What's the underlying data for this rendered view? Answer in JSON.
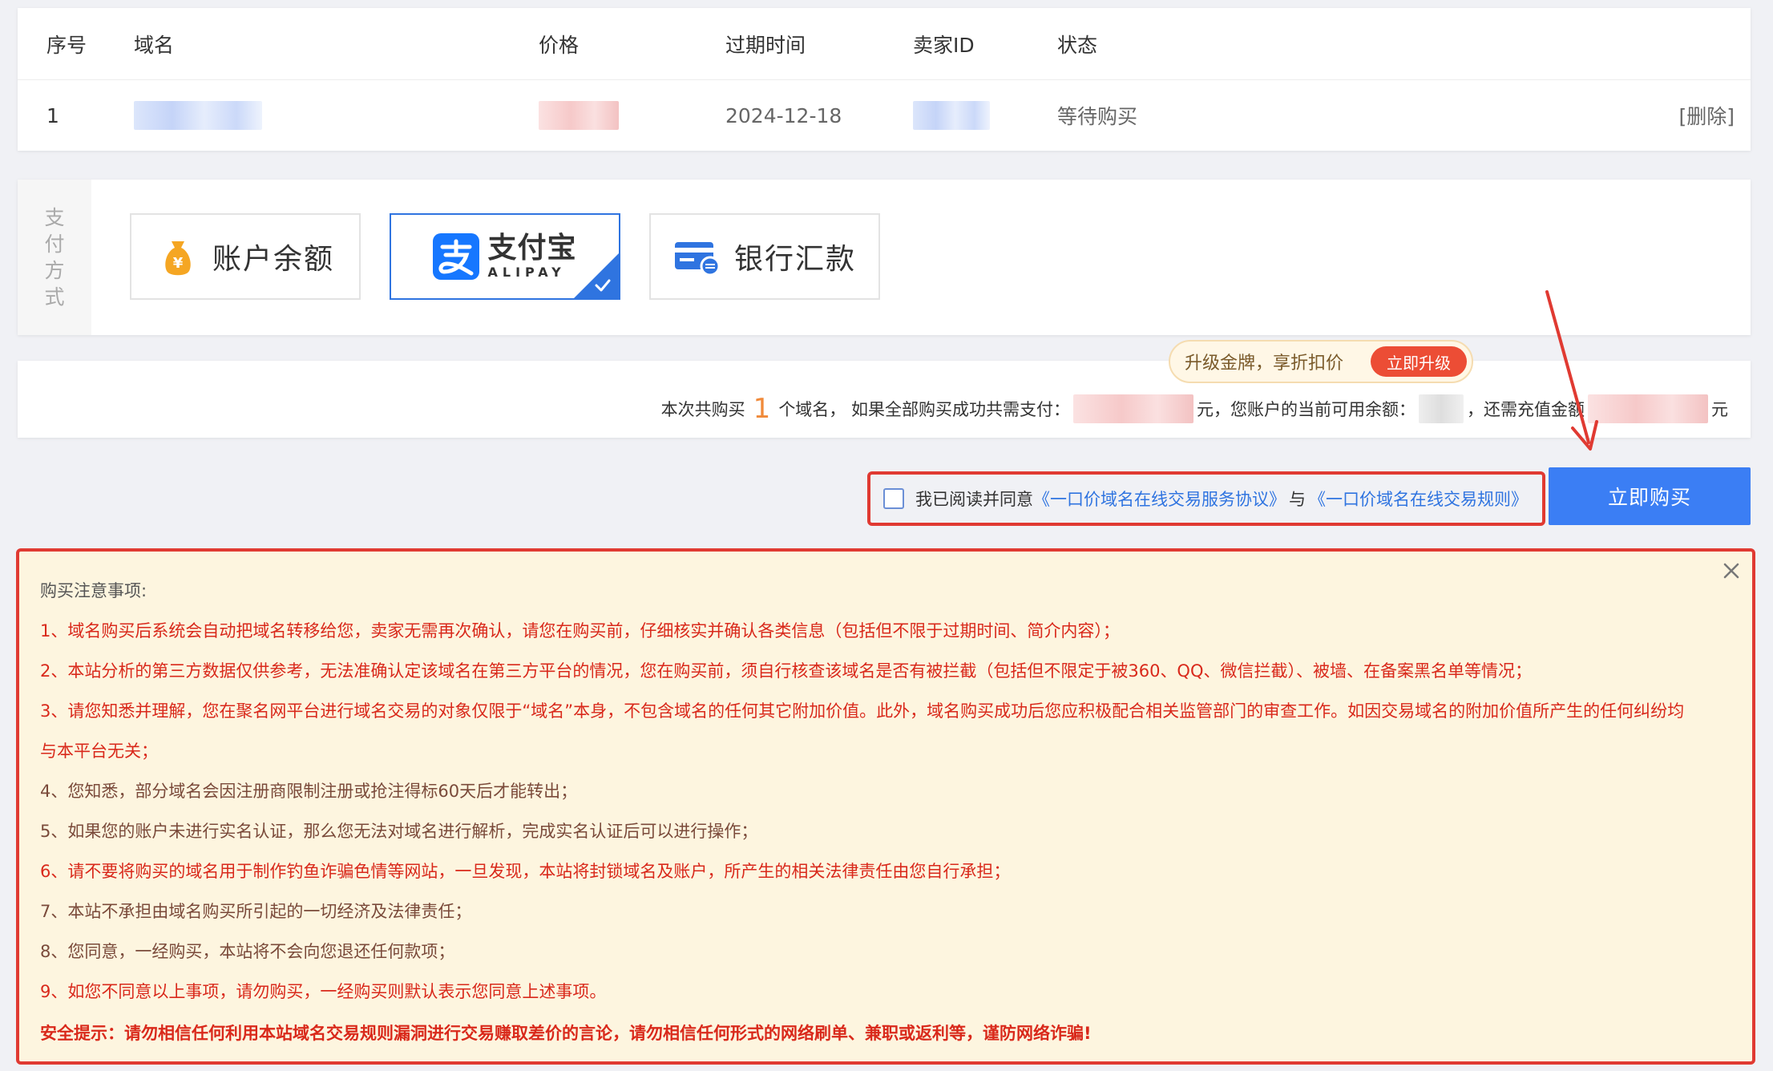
{
  "table": {
    "headers": {
      "index": "序号",
      "domain": "域名",
      "price": "价格",
      "expiry": "过期时间",
      "seller": "卖家ID",
      "status": "状态"
    },
    "rows": [
      {
        "index": "1",
        "expiry": "2024-12-18",
        "status": "等待购买",
        "delete_label": "[删除]"
      }
    ]
  },
  "payment": {
    "label": [
      "支",
      "付",
      "方",
      "式"
    ],
    "options": [
      {
        "label": "账户余额",
        "icon": "money-bag-icon",
        "selected": false
      },
      {
        "label_cn": "支付宝",
        "label_en": "ALIPAY",
        "icon": "alipay-logo-icon",
        "selected": true
      },
      {
        "label": "银行汇款",
        "icon": "bank-card-icon",
        "selected": false
      }
    ]
  },
  "upgrade": {
    "text": "升级金牌，享折扣价",
    "button": "立即升级"
  },
  "summary": {
    "prefix": "本次共购买",
    "count": "1",
    "mid1": "个域名，  如果全部购买成功共需支付：",
    "unit1": "元，",
    "mid2": "您账户的当前可用余额：",
    "mid3": "，还需充值金额",
    "unit2": "元"
  },
  "agree": {
    "text": "我已阅读并同意",
    "link1": "《一口价域名在线交易服务协议》",
    "and": "与",
    "link2": "《一口价域名在线交易规则》"
  },
  "buy_button": "立即购买",
  "notice": {
    "title": "购买注意事项:",
    "items": [
      "1、域名购买后系统会自动把域名转移给您，卖家无需再次确认，请您在购买前，仔细核实并确认各类信息（包括但不限于过期时间、简介内容）；",
      "2、本站分析的第三方数据仅供参考，无法准确认定该域名在第三方平台的情况，您在购买前，须自行核查该域名是否有被拦截（包括但不限定于被360、QQ、微信拦截）、被墙、在备案黑名单等情况；",
      "3、请您知悉并理解，您在聚名网平台进行域名交易的对象仅限于“域名”本身，不包含域名的任何其它附加价值。此外，域名购买成功后您应积极配合相关监管部门的审查工作。如因交易域名的附加价值所产生的任何纠纷均",
      "与本平台无关；",
      "4、您知悉，部分域名会因注册商限制注册或抢注得标60天后才能转出；",
      "5、如果您的账户未进行实名认证，那么您无法对域名进行解析，完成实名认证后可以进行操作；",
      "6、请不要将购买的域名用于制作钓鱼诈骗色情等网站，一旦发现，本站将封锁域名及账户，所产生的相关法律责任由您自行承担；",
      "7、本站不承担由域名购买所引起的一切经济及法律责任；",
      "8、您同意，一经购买，本站将不会向您退还任何款项；",
      "9、如您不同意以上事项，请勿购买，一经购买则默认表示您同意上述事项。"
    ],
    "safety": "安全提示：请勿相信任何利用本站域名交易规则漏洞进行交易赚取差价的言论，请勿相信任何形式的网络刷单、兼职或返利等，谨防网络诈骗!"
  },
  "colors": {
    "accent": "#3b7ef4",
    "link": "#2f74e0",
    "warning_red": "#d9291b",
    "annotation_red": "#e03a32",
    "notice_bg": "#fdf5df",
    "count_orange": "#f08a3a"
  }
}
